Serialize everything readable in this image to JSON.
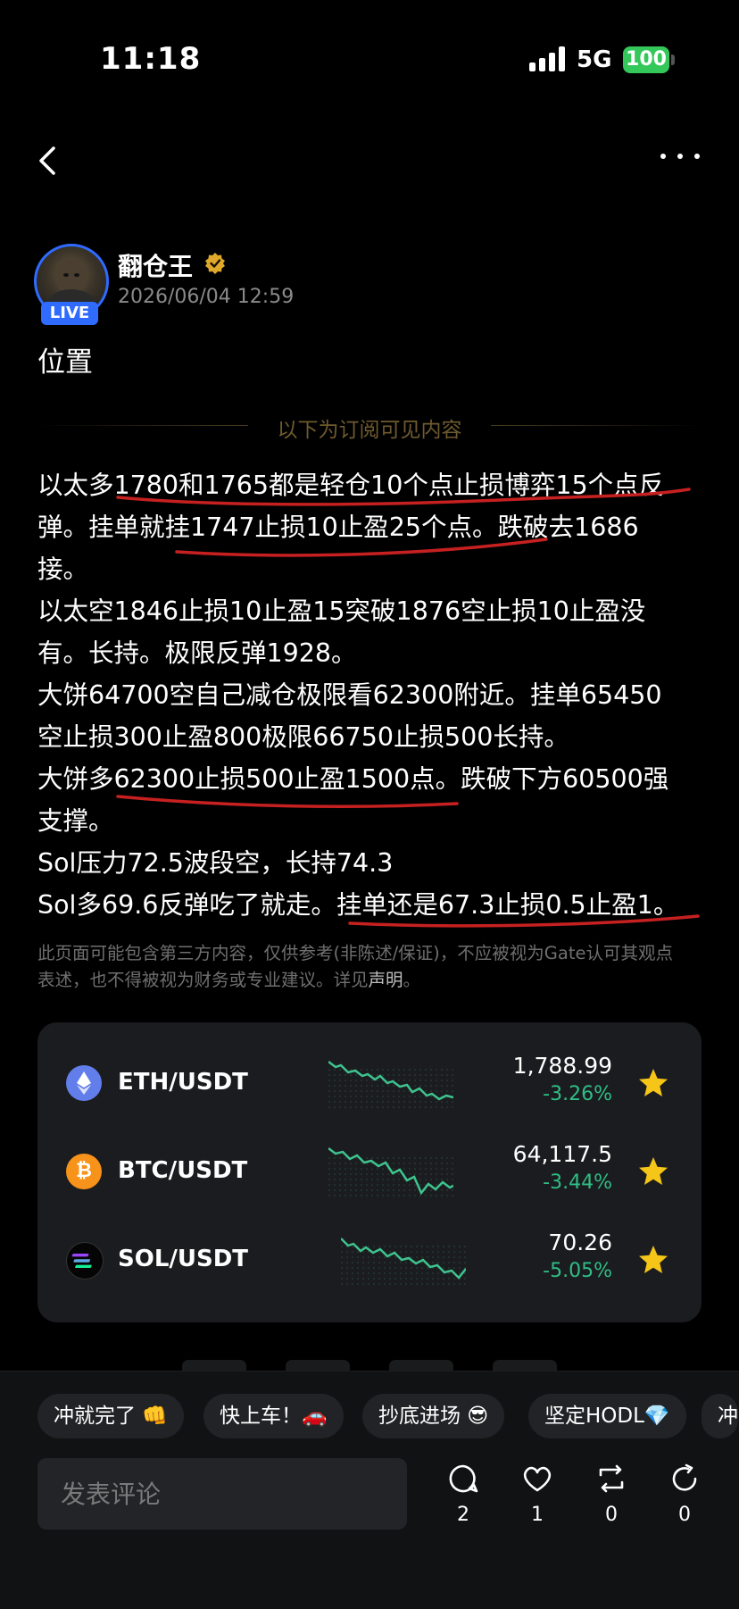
{
  "status_bar": {
    "time": "11:18",
    "network": "5G",
    "battery": "100"
  },
  "post": {
    "author": "翻仓王",
    "avatar_badge": "LIVE",
    "timestamp": "2026/06/04 12:59",
    "title": "位置",
    "divider_label": "以下为订阅可见内容",
    "lines": [
      "以太多1780和1765都是轻仓10个点止损博弈15个点反",
      "弹。挂单就挂1747止损10止盈25个点。跌破去1686",
      "接。",
      "以太空1846止损10止盈15突破1876空止损10止盈没",
      "有。长持。极限反弹1928。",
      "大饼64700空自己减仓极限看62300附近。挂单65450",
      "空止损300止盈800极限66750止损500长持。",
      "大饼多62300止损500止盈1500点。跌破下方60500强",
      "支撑。",
      "Sol压力72.5波段空，长持74.3",
      "Sol多69.6反弹吃了就走。挂单还是67.3止损0.5止盈1。"
    ],
    "disclaimer_line1": "此页面可能包含第三方内容，仅供参考(非陈述/保证)，不应被视为Gate认可其观点",
    "disclaimer_line2_prefix": "表述，也不得被视为财务或专业建议。详见",
    "disclaimer_link": "声明",
    "disclaimer_suffix": "。"
  },
  "markets": [
    {
      "pair": "ETH/USDT",
      "price": "1,788.99",
      "change": "-3.26%",
      "icon": "eth-icon",
      "color": "#627eea"
    },
    {
      "pair": "BTC/USDT",
      "price": "64,117.5",
      "change": "-3.44%",
      "icon": "btc-icon",
      "color": "#f7931a"
    },
    {
      "pair": "SOL/USDT",
      "price": "70.26",
      "change": "-5.05%",
      "icon": "sol-icon",
      "color": "#000000"
    }
  ],
  "quick_replies": [
    "冲就完了 👊",
    "快上车！🚗",
    "抄底进场 😎",
    "坚定HODL💎",
    "冲"
  ],
  "comment": {
    "placeholder": "发表评论"
  },
  "actions": {
    "comments": "2",
    "likes": "1",
    "reposts": "0",
    "shares": "0"
  },
  "colors": {
    "accent_green": "#2fbd85",
    "live_blue": "#2f6bff",
    "star_yellow": "#f5c518",
    "highlight_red": "#c62020"
  }
}
